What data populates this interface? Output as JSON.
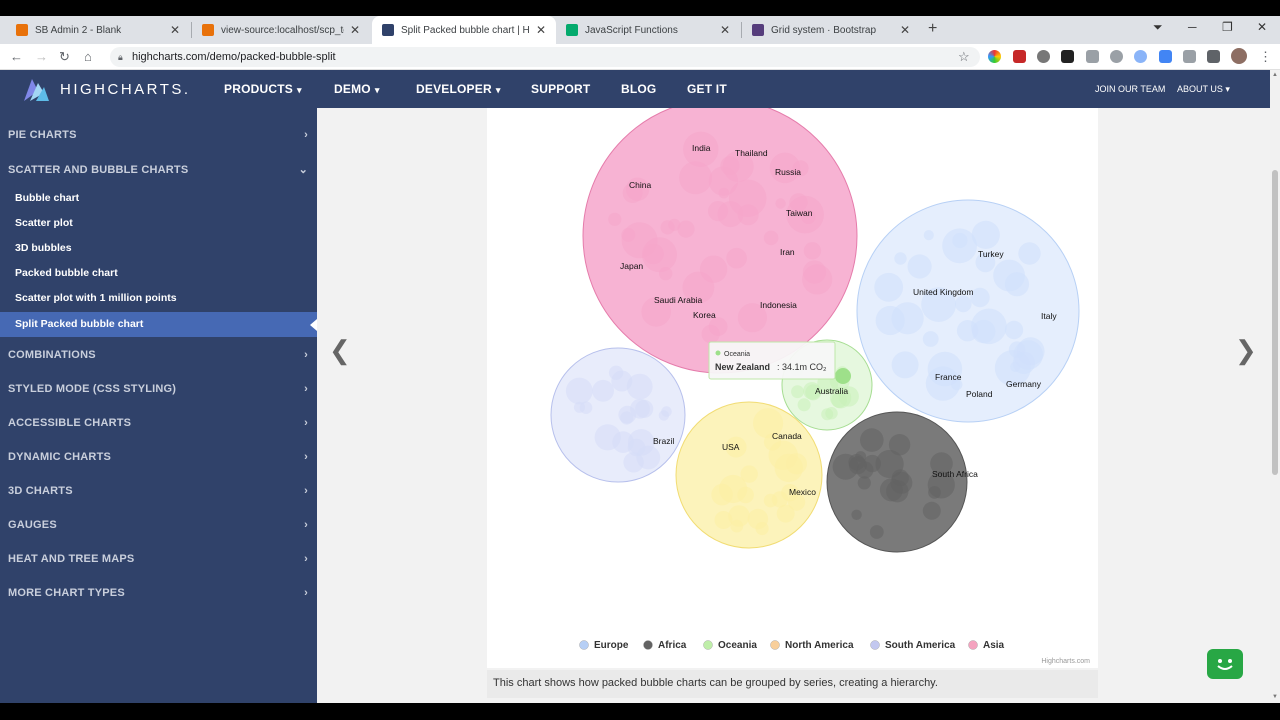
{
  "browser": {
    "tabs": [
      {
        "title": "SB Admin 2 - Blank",
        "color": "#e8710a"
      },
      {
        "title": "view-source:localhost/scp_test/m",
        "color": "#e8710a"
      },
      {
        "title": "Split Packed bubble chart | Highc",
        "color": "#30426a"
      },
      {
        "title": "JavaScript Functions",
        "color": "#04aa6d"
      },
      {
        "title": "Grid system · Bootstrap",
        "color": "#563d7c"
      }
    ],
    "url": "highcharts.com/demo/packed-bubble-split"
  },
  "site": {
    "logo_text": "HIGHCHARTS.",
    "nav": [
      {
        "label": "PRODUCTS",
        "dropdown": true
      },
      {
        "label": "DEMO",
        "dropdown": true
      },
      {
        "label": "DEVELOPER",
        "dropdown": true
      },
      {
        "label": "SUPPORT",
        "dropdown": false
      },
      {
        "label": "BLOG",
        "dropdown": false
      },
      {
        "label": "GET IT",
        "dropdown": false
      }
    ],
    "secondary_nav": [
      {
        "label": "JOIN OUR TEAM"
      },
      {
        "label": "ABOUT US"
      }
    ]
  },
  "sidebar": {
    "sections": [
      {
        "label": "PIE CHARTS",
        "expanded": false
      },
      {
        "label": "SCATTER AND BUBBLE CHARTS",
        "expanded": true,
        "items": [
          {
            "label": "Bubble chart"
          },
          {
            "label": "Scatter plot"
          },
          {
            "label": "3D bubbles"
          },
          {
            "label": "Packed bubble chart"
          },
          {
            "label": "Scatter plot with 1 million points"
          },
          {
            "label": "Split Packed bubble chart",
            "active": true
          }
        ]
      },
      {
        "label": "COMBINATIONS",
        "expanded": false
      },
      {
        "label": "STYLED MODE (CSS STYLING)",
        "expanded": false
      },
      {
        "label": "ACCESSIBLE CHARTS",
        "expanded": false
      },
      {
        "label": "DYNAMIC CHARTS",
        "expanded": false
      },
      {
        "label": "3D CHARTS",
        "expanded": false
      },
      {
        "label": "GAUGES",
        "expanded": false
      },
      {
        "label": "HEAT AND TREE MAPS",
        "expanded": false
      },
      {
        "label": "MORE CHART TYPES",
        "expanded": false
      }
    ]
  },
  "chart_data": {
    "type": "packed-bubble",
    "series": [
      {
        "name": "Europe",
        "color": "#cfe0fb",
        "stroke": "#b7d0f5",
        "labels": [
          "Turkey",
          "United Kingdom",
          "Italy",
          "France",
          "Germany",
          "Poland"
        ]
      },
      {
        "name": "Africa",
        "color": "#636363",
        "stroke": "#555555",
        "labels": [
          "South Africa"
        ]
      },
      {
        "name": "Oceania",
        "color": "#c8f0b8",
        "stroke": "#a6dd92",
        "labels": [
          "Australia"
        ]
      },
      {
        "name": "North America",
        "color": "#fbefa4",
        "stroke": "#f1dc73",
        "labels": [
          "USA",
          "Canada",
          "Mexico"
        ]
      },
      {
        "name": "South America",
        "color": "#d6dcf8",
        "stroke": "#b7c0ec",
        "labels": [
          "Brazil"
        ]
      },
      {
        "name": "Asia",
        "color": "#f6a6cb",
        "stroke": "#e57cab",
        "labels": [
          "India",
          "Thailand",
          "China",
          "Russia",
          "Taiwan",
          "Iran",
          "Japan",
          "Saudi Arabia",
          "Indonesia",
          "Korea"
        ]
      }
    ],
    "legend": [
      "Europe",
      "Africa",
      "Oceania",
      "North America",
      "South America",
      "Asia"
    ],
    "legend_colors": [
      "#b7cff5",
      "#636363",
      "#bfeea9",
      "#f8cf9b",
      "#c3c8ef",
      "#f4a3bf"
    ],
    "tooltip": {
      "series": "Oceania",
      "point": "New Zealand",
      "value_text": "34.1m CO₂"
    },
    "credits": "Highcharts.com"
  },
  "caption": "This chart shows how packed bubble charts can be grouped by series, creating a hierarchy."
}
